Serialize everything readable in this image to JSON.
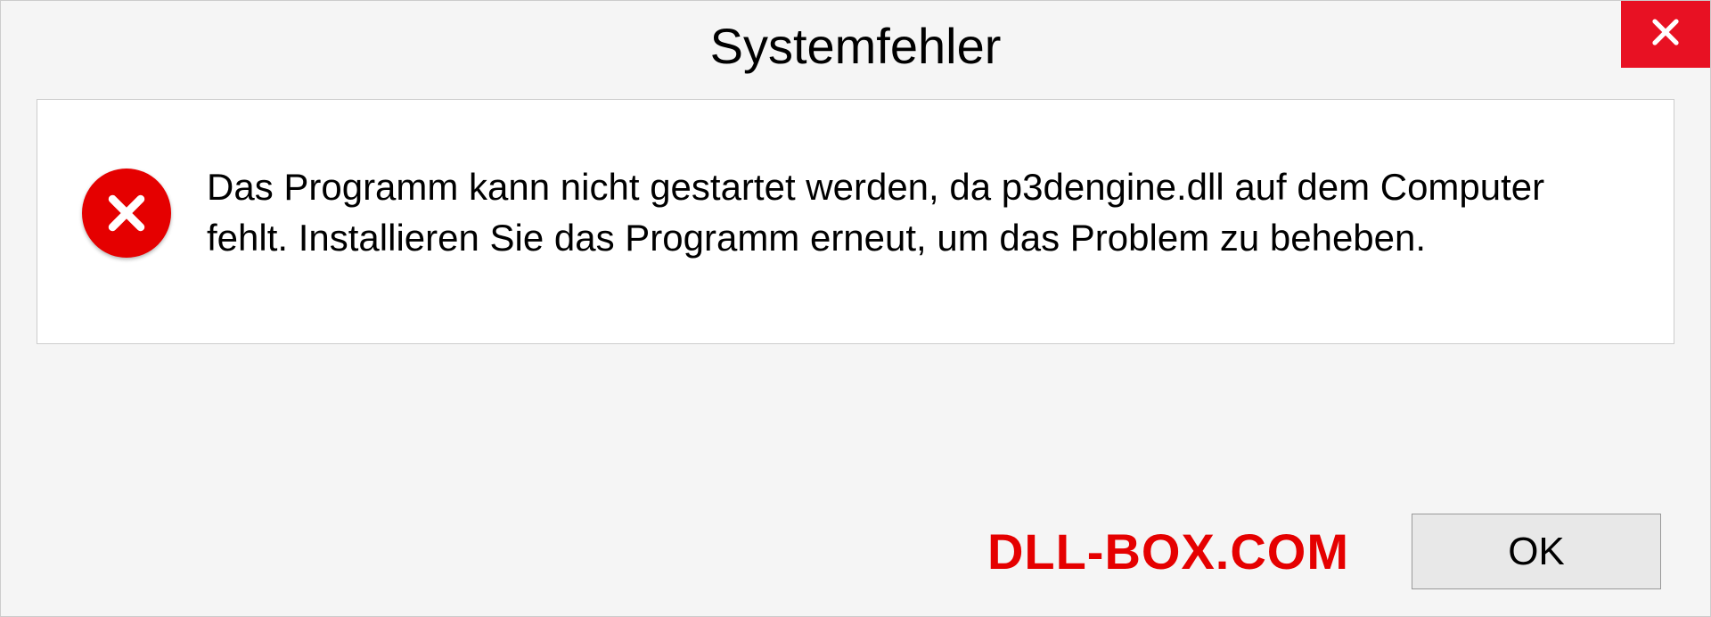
{
  "dialog": {
    "title": "Systemfehler",
    "message": "Das Programm kann nicht gestartet werden, da p3dengine.dll auf dem Computer fehlt. Installieren Sie das Programm erneut, um das Problem zu beheben.",
    "ok_label": "OK"
  },
  "watermark": "DLL-BOX.COM"
}
